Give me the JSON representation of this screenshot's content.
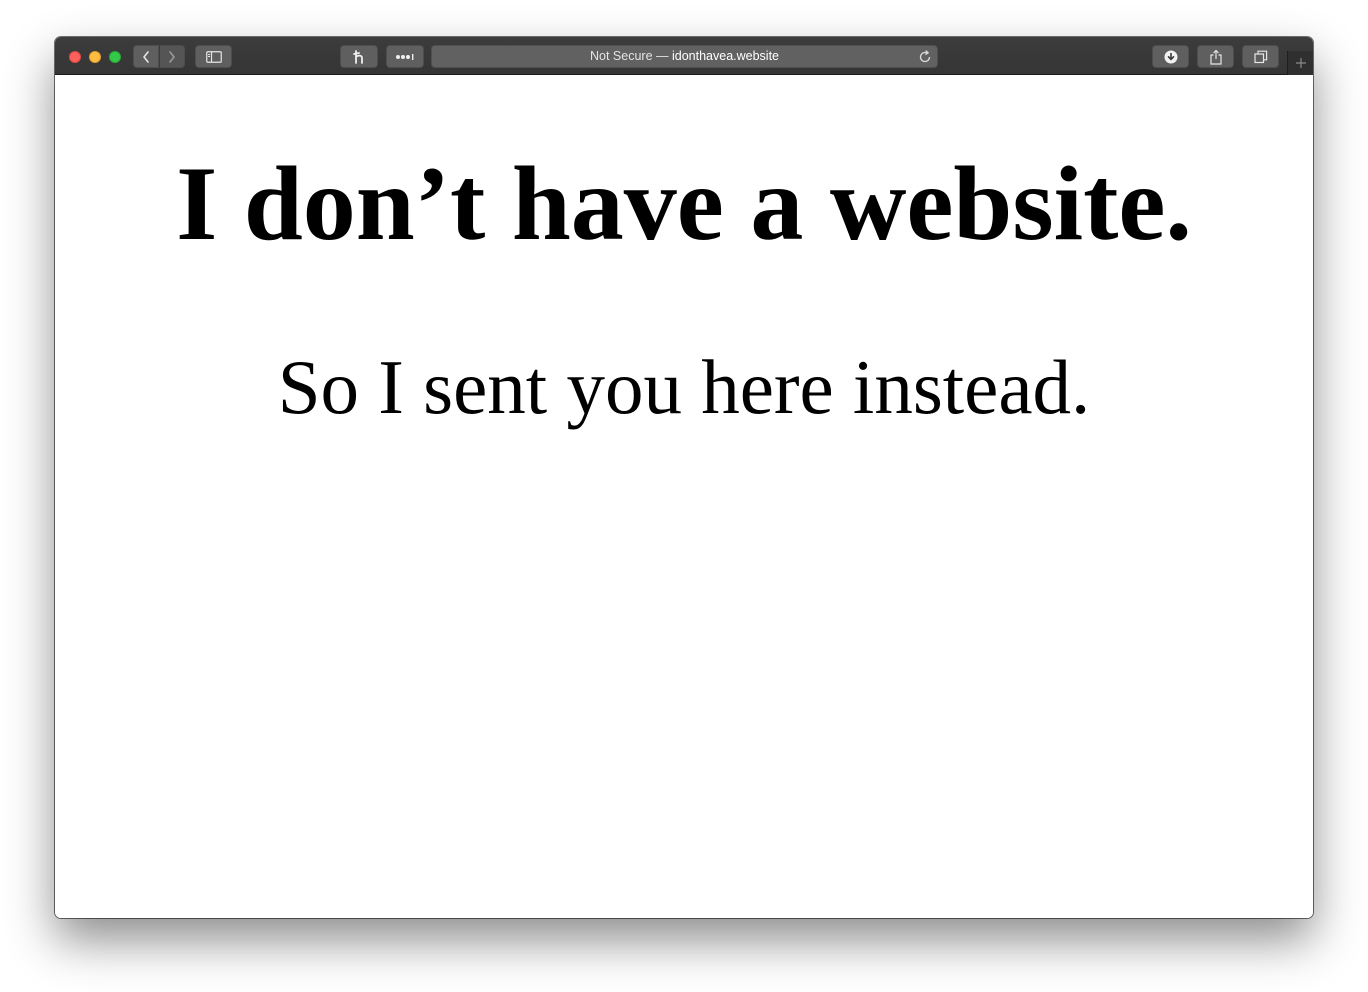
{
  "browser": {
    "address_bar": {
      "security_label": "Not Secure —",
      "domain": "idonthavea.website"
    },
    "icons": {
      "back": "chevron-left-icon",
      "forward": "chevron-right-icon",
      "sidebar": "sidebar-icon",
      "extension_1": "honey-extension-icon",
      "extension_2": "more-dots-icon",
      "reload": "reload-icon",
      "downloads": "download-icon",
      "share": "share-icon",
      "tabs": "tab-overview-icon",
      "new_tab": "plus-icon"
    },
    "colors": {
      "close": "#fc605c",
      "minimize": "#fdbc40",
      "maximize": "#34c84a",
      "toolbar": "#3a3a3a"
    }
  },
  "page": {
    "headline": "I don’t have a website.",
    "subline": "So I sent you here instead."
  }
}
